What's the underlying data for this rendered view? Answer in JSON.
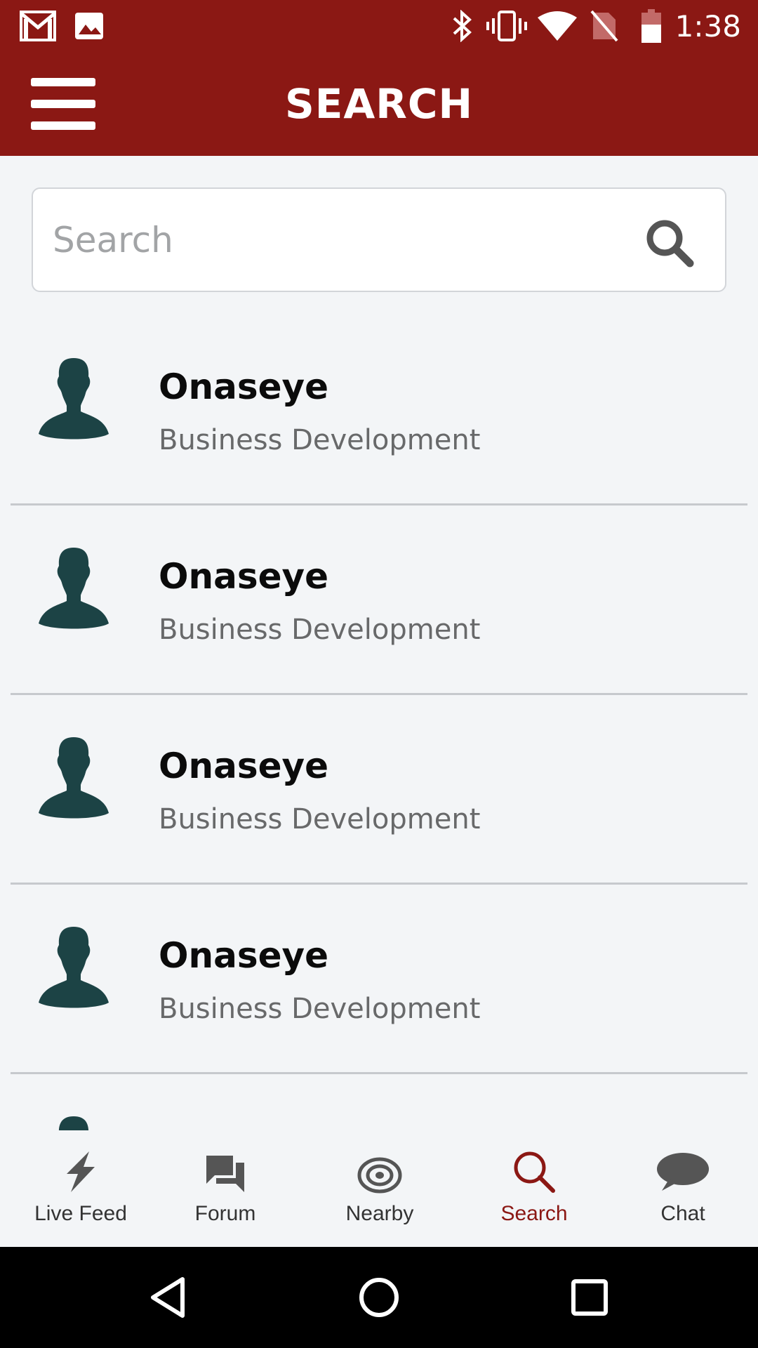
{
  "colors": {
    "brand": "#8b1814",
    "background": "#f3f5f7",
    "avatar": "#1c4345",
    "nav_inactive": "#555555",
    "nav_active": "#8b1814"
  },
  "status_bar": {
    "time": "1:38",
    "icons": [
      "gmail-icon",
      "image-icon",
      "bluetooth-icon",
      "vibrate-icon",
      "wifi-icon",
      "no-sim-icon",
      "battery-icon"
    ]
  },
  "app_bar": {
    "title": "SEARCH"
  },
  "search": {
    "placeholder": "Search",
    "value": ""
  },
  "results": [
    {
      "name": "Onaseye",
      "role": "Business Development"
    },
    {
      "name": "Onaseye",
      "role": "Business Development"
    },
    {
      "name": "Onaseye",
      "role": "Business Development"
    },
    {
      "name": "Onaseye",
      "role": "Business Development"
    }
  ],
  "bottom_nav": [
    {
      "label": "Live Feed",
      "icon": "lightning-icon",
      "active": false
    },
    {
      "label": "Forum",
      "icon": "forum-icon",
      "active": false
    },
    {
      "label": "Nearby",
      "icon": "target-icon",
      "active": false
    },
    {
      "label": "Search",
      "icon": "search-icon",
      "active": true
    },
    {
      "label": "Chat",
      "icon": "chat-bubble-icon",
      "active": false
    }
  ],
  "system_nav": [
    "back-icon",
    "home-icon",
    "recents-icon"
  ]
}
